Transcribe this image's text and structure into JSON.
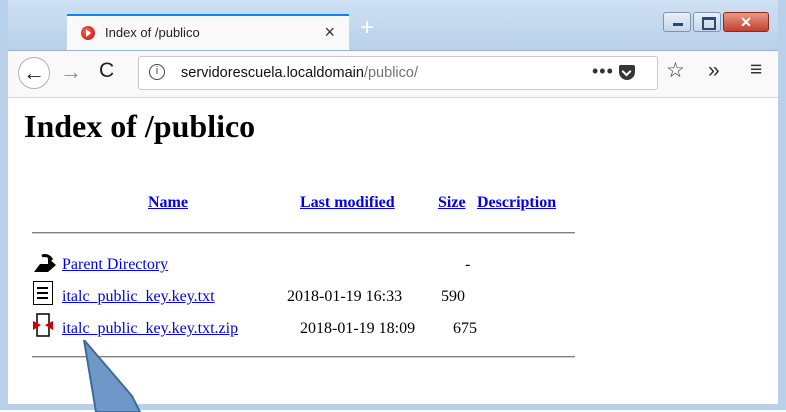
{
  "browser": {
    "tab_title": "Index of /publico",
    "tab_close": "×",
    "new_tab": "+",
    "url_host": "servidorescuela.localdomain",
    "url_path": "/publico/",
    "page_actions": "•••",
    "icons": {
      "back": "back-arrow",
      "forward": "forward-arrow",
      "reload": "reload",
      "info": "info",
      "pocket": "pocket",
      "bookmark": "star",
      "overflow": "chevron-double-right",
      "menu": "hamburger"
    }
  },
  "page": {
    "heading": "Index of /publico",
    "columns": {
      "name": "Name",
      "modified": "Last modified",
      "size": "Size",
      "description": "Description"
    },
    "rows": [
      {
        "icon": "parent-directory-icon",
        "name": "Parent Directory",
        "modified": "",
        "size": "-"
      },
      {
        "icon": "text-file-icon",
        "name": "italc_public_key.key.txt",
        "modified": "2018-01-19 16:33",
        "size": "590"
      },
      {
        "icon": "zip-file-icon",
        "name": "italc_public_key.key.txt.zip",
        "modified": "2018-01-19 18:09",
        "size": "675"
      }
    ]
  },
  "colors": {
    "link": "#0000ee",
    "accent_tab": "#0a84ff",
    "annotation_arrow": "#6f98c9"
  }
}
